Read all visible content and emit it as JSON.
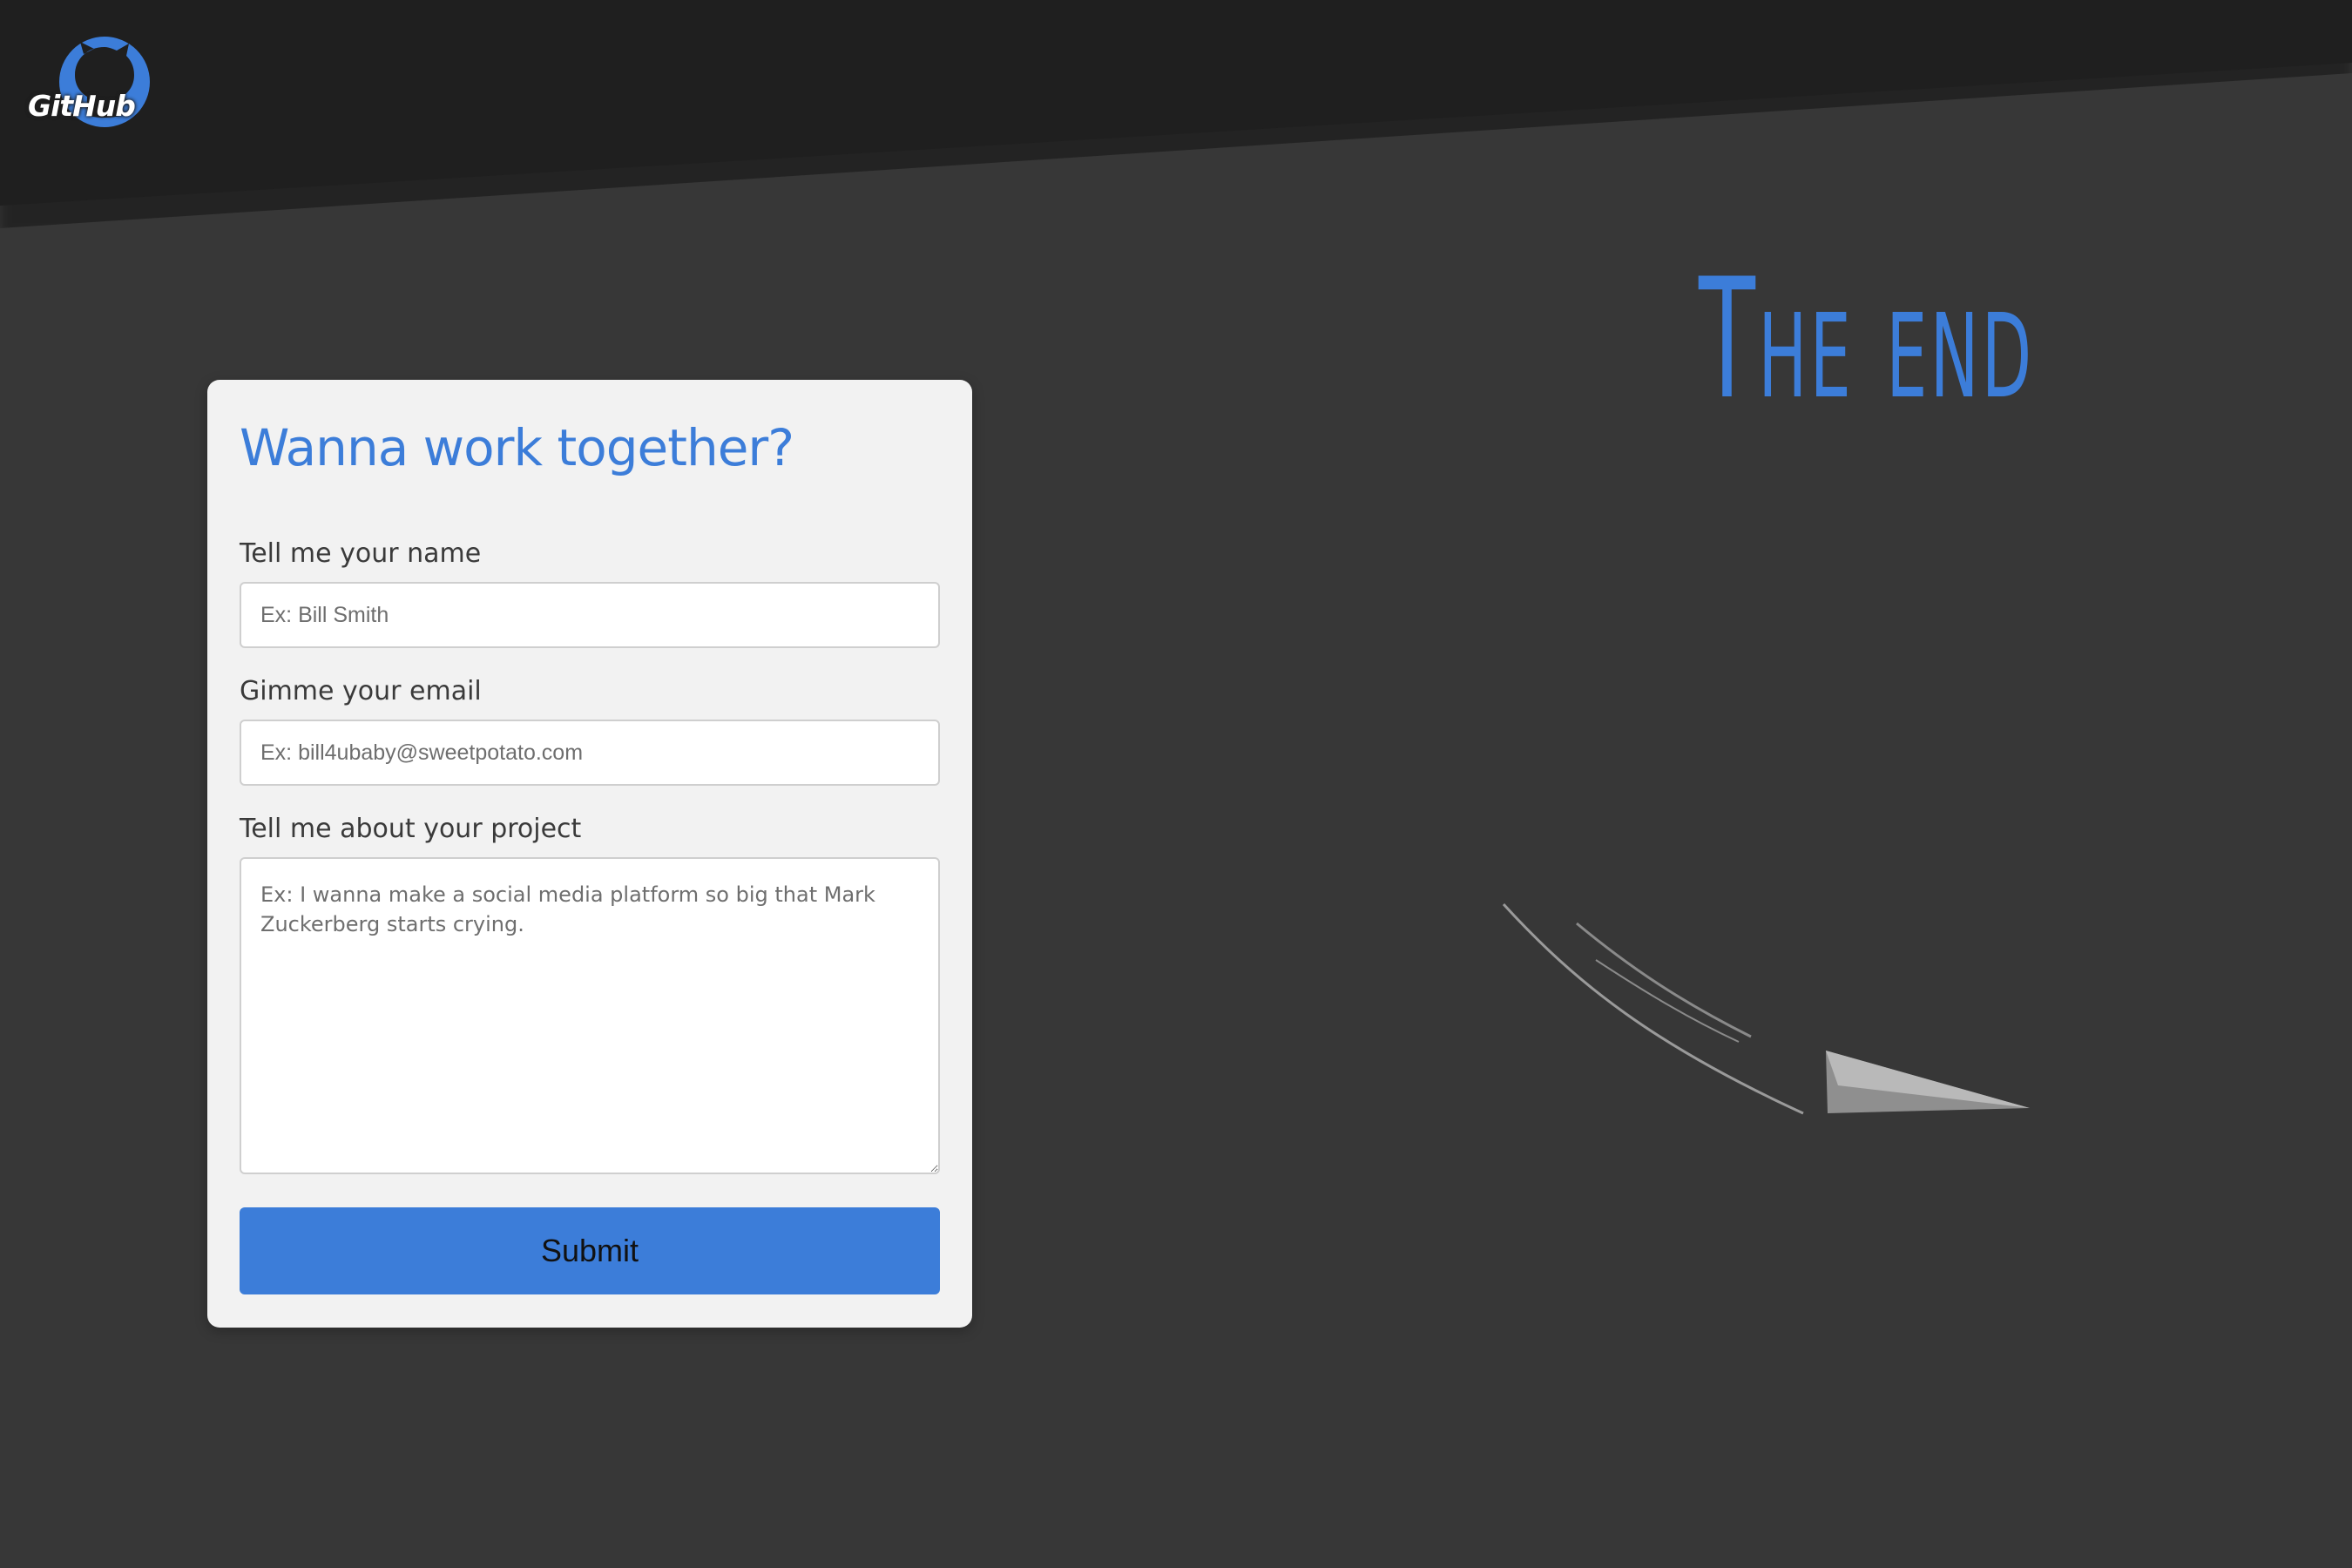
{
  "brand": {
    "logo_text": "GitHub",
    "icon": "github-octocat-icon",
    "accent_color": "#3c7dd9"
  },
  "hero": {
    "title": "The end"
  },
  "form": {
    "title": "Wanna work together?",
    "name_label": "Tell me your name",
    "name_placeholder": "Ex: Bill Smith",
    "email_label": "Gimme your email",
    "email_placeholder": "Ex: bill4ubaby@sweetpotato.com",
    "project_label": "Tell me about your project",
    "project_placeholder": "Ex: I wanna make a social media platform so big that Mark Zuckerberg starts crying.",
    "submit_label": "Submit"
  },
  "colors": {
    "page_background": "#373737",
    "header_background": "#1f1f1f",
    "card_background": "#f2f2f2",
    "button_background": "#3c7dd9"
  }
}
